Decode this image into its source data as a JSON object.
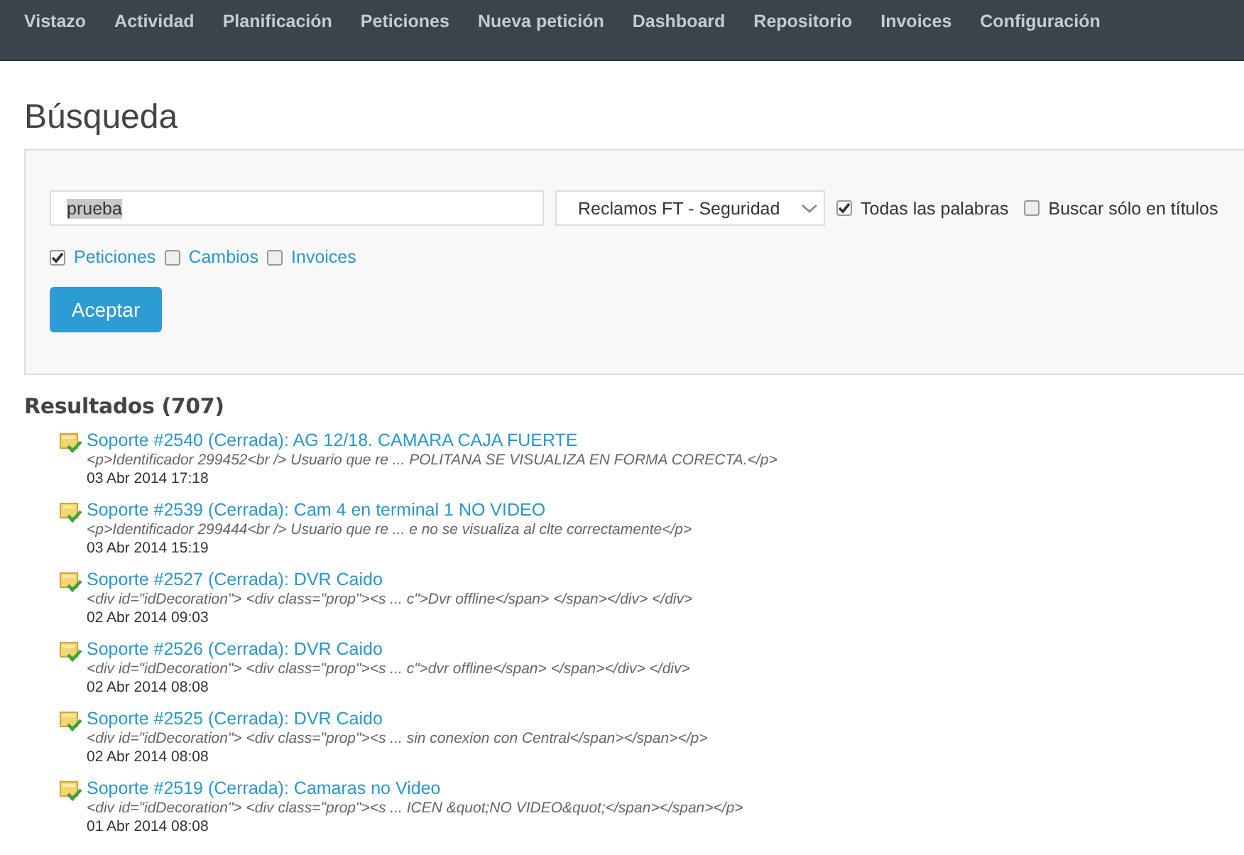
{
  "nav": {
    "items": [
      "Vistazo",
      "Actividad",
      "Planificación",
      "Peticiones",
      "Nueva petición",
      "Dashboard",
      "Repositorio",
      "Invoices",
      "Configuración"
    ]
  },
  "page_title": "Búsqueda",
  "search": {
    "value": "prueba",
    "project": "Reclamos FT - Seguridad",
    "options": [
      {
        "label": "Todas las palabras",
        "checked": true
      },
      {
        "label": "Buscar sólo en títulos",
        "checked": false
      }
    ],
    "types": [
      {
        "label": "Peticiones",
        "checked": true
      },
      {
        "label": "Cambios",
        "checked": false
      },
      {
        "label": "Invoices",
        "checked": false
      }
    ],
    "submit": "Aceptar"
  },
  "results": {
    "heading": "Resultados (707)",
    "items": [
      {
        "title": "Soporte #2540 (Cerrada): AG 12/18. CAMARA CAJA FUERTE",
        "excerpt": "<p>Identificador 299452<br /> Usuario que re ... POLITANA SE VISUALIZA EN FORMA CORECTA.</p>",
        "date": "03 Abr 2014 17:18"
      },
      {
        "title": "Soporte #2539 (Cerrada): Cam 4 en terminal 1 NO VIDEO",
        "excerpt": "<p>Identificador 299444<br /> Usuario que re ... e no se visualiza al clte correctamente</p>",
        "date": "03 Abr 2014 15:19"
      },
      {
        "title": "Soporte #2527 (Cerrada): DVR Caido",
        "excerpt": "<div id=\"idDecoration\"> <div class=\"prop\"><s ... c\">Dvr offline</span> </span></div> </div>",
        "date": "02 Abr 2014 09:03"
      },
      {
        "title": "Soporte #2526 (Cerrada): DVR Caido",
        "excerpt": "<div id=\"idDecoration\"> <div class=\"prop\"><s ... c\">dvr offline</span> </span></div> </div>",
        "date": "02 Abr 2014 08:08"
      },
      {
        "title": "Soporte #2525 (Cerrada): DVR Caido",
        "excerpt": "<div id=\"idDecoration\"> <div class=\"prop\"><s ... sin conexion con Central</span></span></p>",
        "date": "02 Abr 2014 08:08"
      },
      {
        "title": "Soporte #2519 (Cerrada): Camaras no Video",
        "excerpt": "<div id=\"idDecoration\"> <div class=\"prop\"><s ... ICEN &quot;NO VIDEO&quot;</span></span></p>",
        "date": "01 Abr 2014 08:08"
      }
    ]
  }
}
